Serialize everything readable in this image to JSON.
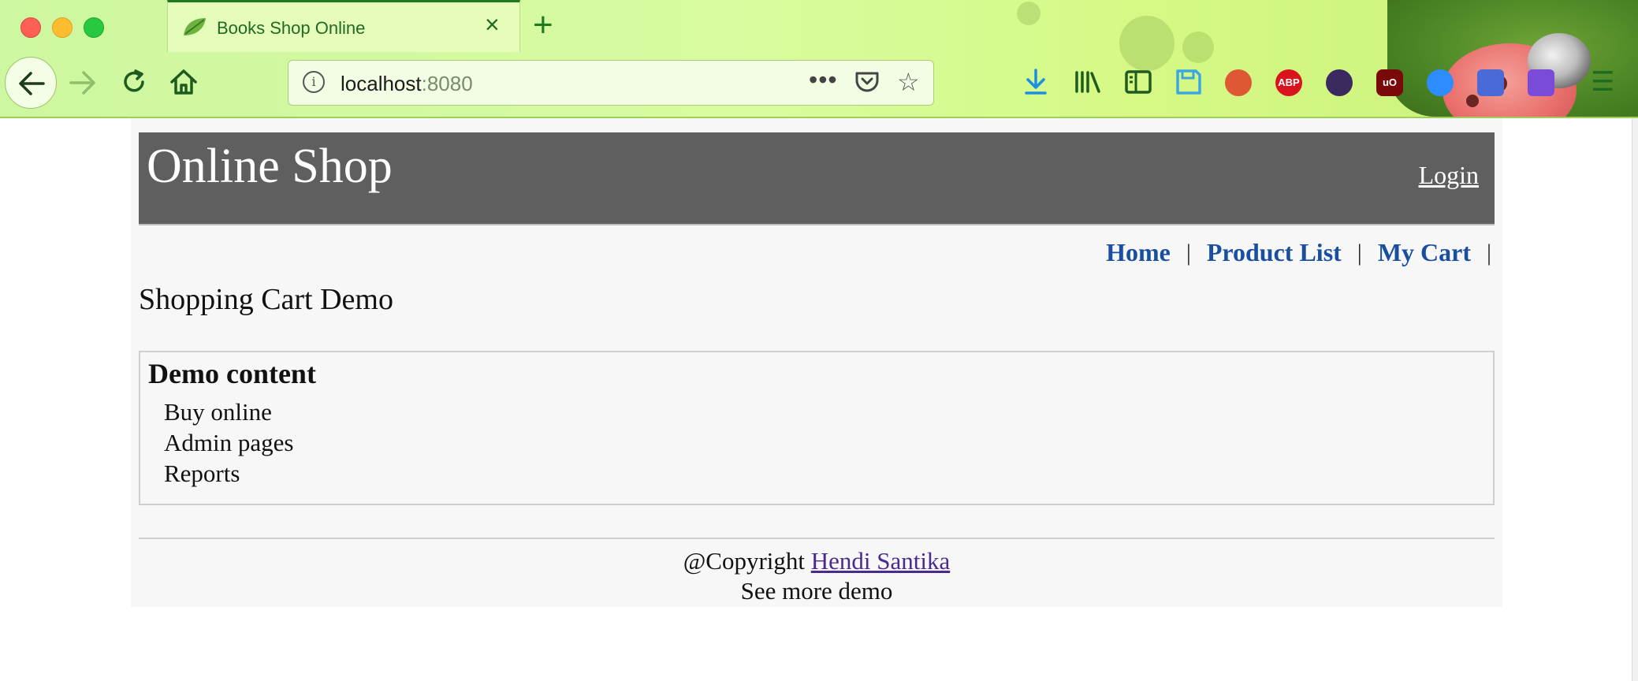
{
  "browser": {
    "tab": {
      "title": "Books Shop Online",
      "close_glyph": "×"
    },
    "new_tab_glyph": "+",
    "url": {
      "host": "localhost",
      "port": ":8080"
    },
    "page_actions_glyph": "•••",
    "bookmark_glyph": "☆",
    "menu_glyph": "☰",
    "extensions": [
      {
        "name": "downloads-icon",
        "color": "#1a8fe0"
      },
      {
        "name": "library-icon",
        "color": "#1f6b1f"
      },
      {
        "name": "sidebar-icon",
        "color": "#1f6b1f"
      },
      {
        "name": "save-icon",
        "color": "#3aa8e0"
      },
      {
        "name": "duckduckgo-icon",
        "color": "#de5833"
      },
      {
        "name": "adblock-plus-icon",
        "color": "#d9141c",
        "text": "ABP"
      },
      {
        "name": "color-picker-icon",
        "color": "#3a2a60"
      },
      {
        "name": "ublock-origin-icon",
        "color": "#7a0a0a",
        "text": "uO"
      },
      {
        "name": "zoom-icon",
        "color": "#2d8cff"
      },
      {
        "name": "translate-icon",
        "color": "#4a6ad8"
      },
      {
        "name": "puzzle-extension-icon",
        "color": "#7a4ad8"
      }
    ],
    "theme_colors": {
      "chrome_green": "#d8fb9f",
      "accent": "#1f7a1f"
    }
  },
  "site": {
    "title": "Online Shop",
    "login": "Login",
    "nav": [
      {
        "label": "Home"
      },
      {
        "label": "Product List"
      },
      {
        "label": "My Cart"
      }
    ],
    "nav_separator": "|",
    "heading": "Shopping Cart Demo",
    "demo": {
      "title": "Demo content",
      "items": [
        "Buy online",
        "Admin pages",
        "Reports"
      ]
    },
    "footer": {
      "copyright_prefix": "@Copyright",
      "author_link": "Hendi Santika",
      "more": "See more demo"
    },
    "colors": {
      "header_bg": "#5f5f5f",
      "nav_link": "#1a4fa0",
      "visited_link": "#4b2a8f"
    }
  }
}
